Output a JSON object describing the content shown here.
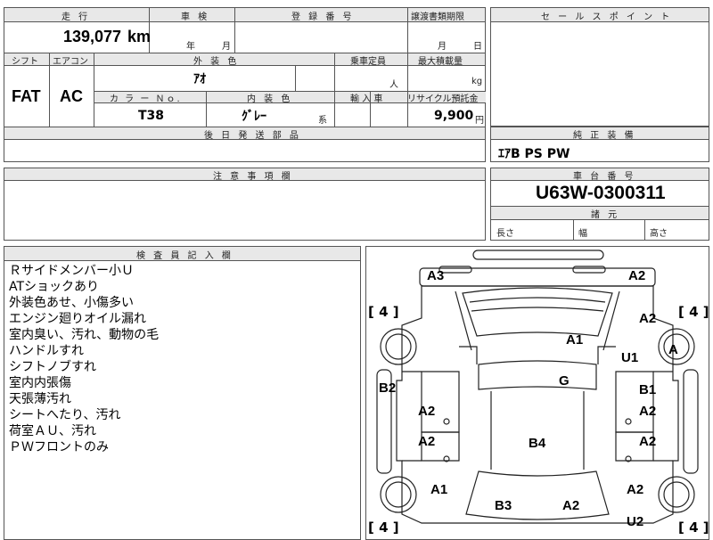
{
  "top": {
    "headers": {
      "mileage": "走 行",
      "inspection": "車 検",
      "registration": "登 録 番 号",
      "transfer_deadline": "譲渡書類期限"
    },
    "mileage_value": "139,077",
    "mileage_unit": "km",
    "inspection_year": "年",
    "inspection_month": "月",
    "transfer_month": "月",
    "transfer_day": "日"
  },
  "specs": {
    "headers": {
      "shift": "シフト",
      "aircon": "エアコン",
      "exterior_color": "外 装 色",
      "capacity": "乗車定員",
      "max_load": "最大積載量",
      "color_no": "カ ラ ー Ｎｏ.",
      "interior_color": "内 装 色",
      "import": "輸 入 車",
      "recycle": "リサイクル預託金"
    },
    "shift": "FAT",
    "aircon": "AC",
    "exterior_color": "ｱｵ",
    "capacity_unit": "人",
    "load_unit": "kg",
    "color_no": "T38",
    "interior_color": "ｸﾞﾚｰ",
    "interior_suffix": "系",
    "recycle_value": "9,900",
    "recycle_unit": "円"
  },
  "later_parts": {
    "header": "後 日 発 送 部 品"
  },
  "sales_points": {
    "header": "セ ー ル ス ポ イ ン ト"
  },
  "oem_equipment": {
    "header": "純 正 装 備",
    "value": "ｴｱB PS PW"
  },
  "caution": {
    "header": "注 意 事 項 欄"
  },
  "chassis": {
    "header": "車 台 番 号",
    "value": "U63W-0300311"
  },
  "dimensions": {
    "header": "諸 元",
    "length": "長さ",
    "width": "幅",
    "height": "高さ"
  },
  "inspector": {
    "header": "検 査 員 記 入 欄",
    "notes": [
      "Ｒサイドメンバー小Ｕ",
      "ATショックあり",
      "外装色あせ、小傷多い",
      "エンジン廻りオイル漏れ",
      "室内臭い、汚れ、動物の毛",
      "ハンドルすれ",
      "シフトノブすれ",
      "室内内張傷",
      "天張薄汚れ",
      "シートへたり、汚れ",
      "荷室ＡＵ、汚れ",
      "ＰＷフロントのみ"
    ]
  },
  "diagram": {
    "tire_marks": [
      "[ 4 ]",
      "[ 4 ]",
      "[ 4 ]",
      "[ 4 ]"
    ],
    "damage": [
      "A3",
      "A2",
      "A2",
      "A1",
      "U1",
      "A",
      "G",
      "B2",
      "B1",
      "A2",
      "A2",
      "A2",
      "B4",
      "A2",
      "A1",
      "A2",
      "B3",
      "A2",
      "U2"
    ]
  }
}
